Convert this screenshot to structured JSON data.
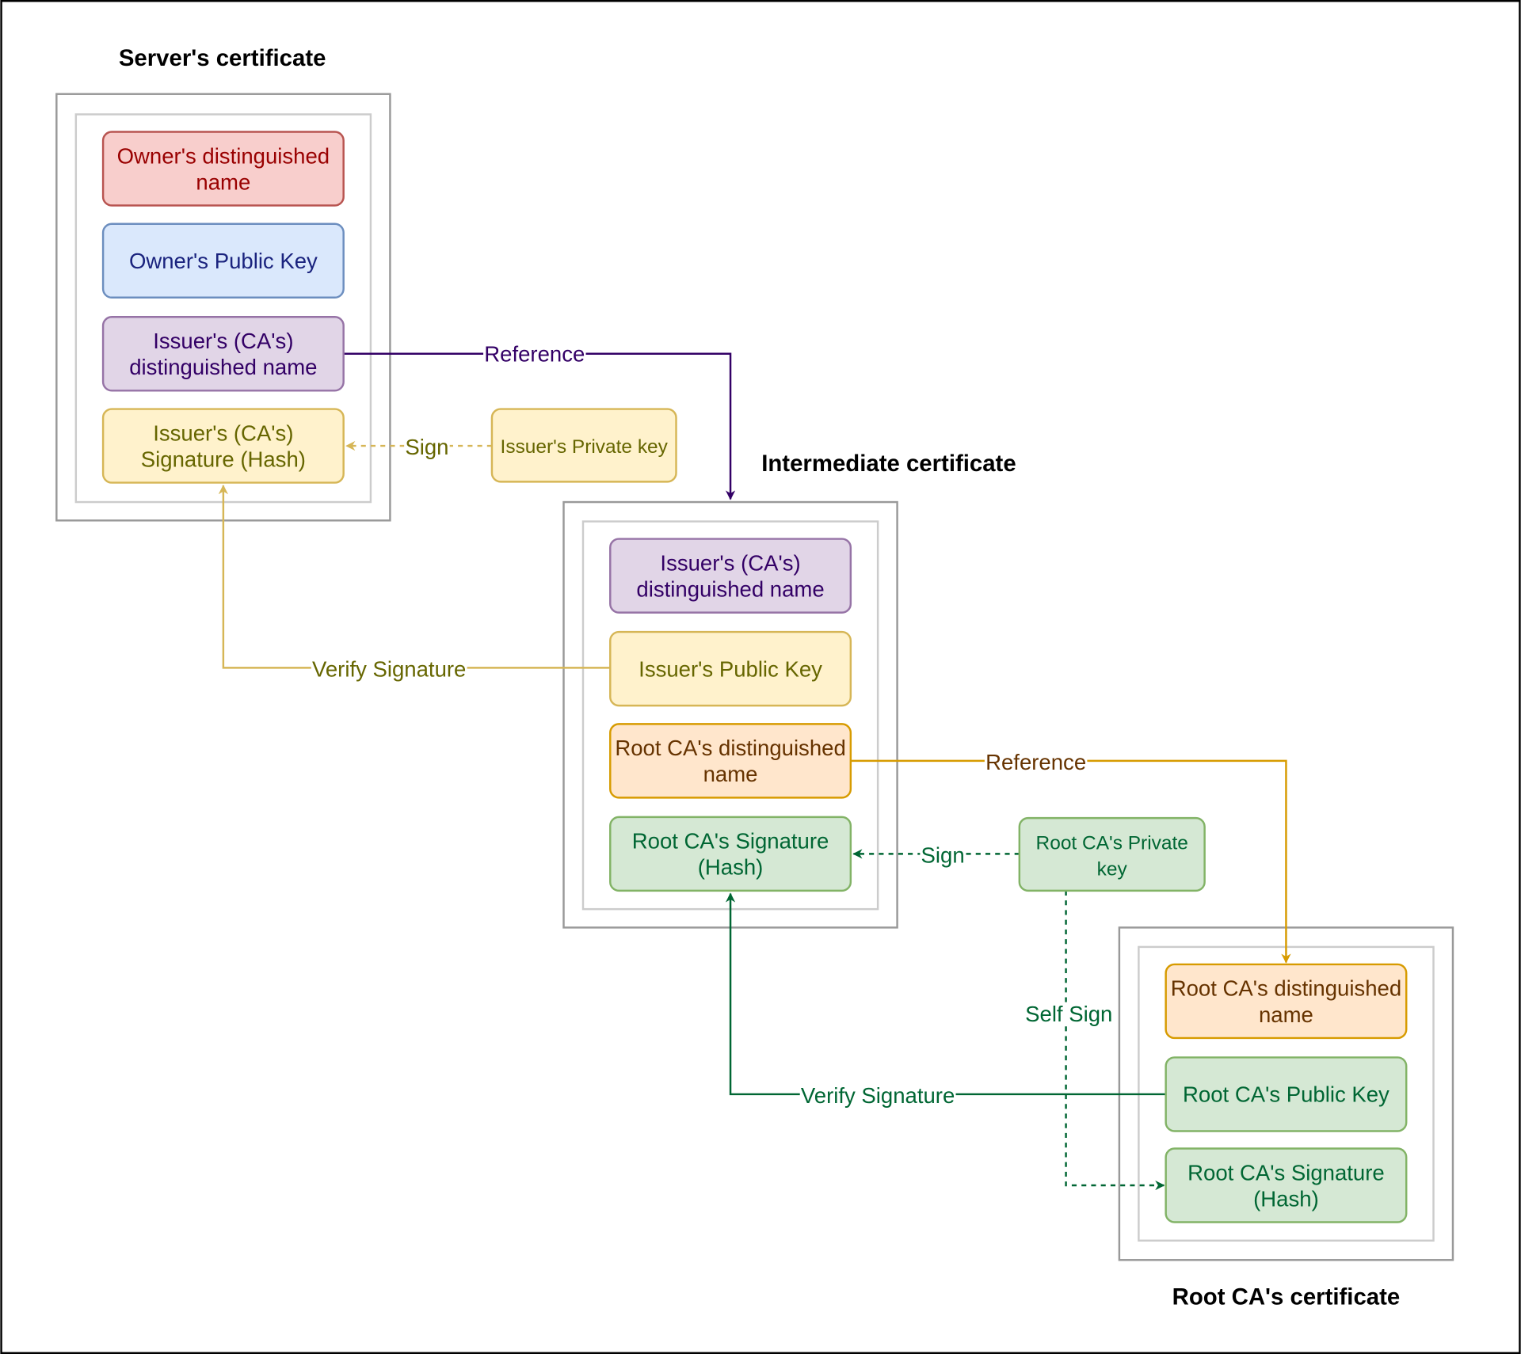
{
  "titles": {
    "server": "Server's certificate",
    "intermediate": "Intermediate certificate",
    "root": "Root CA's certificate"
  },
  "server": {
    "owner_dn": [
      "Owner's distinguished",
      "name"
    ],
    "owner_pk": [
      "Owner's Public Key"
    ],
    "issuer_dn": [
      "Issuer's (CA's)",
      "distinguished name"
    ],
    "issuer_sig": [
      "Issuer's (CA's)",
      "Signature (Hash)"
    ]
  },
  "issuer_private_key": [
    "Issuer's Private key"
  ],
  "intermediate": {
    "issuer_dn": [
      "Issuer's (CA's)",
      "distinguished name"
    ],
    "issuer_pk": [
      "Issuer's Public Key"
    ],
    "root_dn": [
      "Root CA's distinguished",
      "name"
    ],
    "root_sig": [
      "Root CA's Signature",
      "(Hash)"
    ]
  },
  "root_private_key": [
    "Root CA's Private",
    "key"
  ],
  "root": {
    "root_dn": [
      "Root CA's distinguished",
      "name"
    ],
    "root_pk": [
      "Root CA's Public Key"
    ],
    "root_sig": [
      "Root CA's Signature",
      "(Hash)"
    ]
  },
  "edges": {
    "reference_1": "Reference",
    "sign_1": "Sign",
    "verify_1": "Verify Signature",
    "reference_2": "Reference",
    "sign_2": "Sign",
    "self_sign": "Self Sign",
    "verify_2": "Verify Signature"
  },
  "colors": {
    "red": {
      "fill": "#f8cecc",
      "stroke": "#b85450",
      "text": "#990000"
    },
    "blue": {
      "fill": "#dae8fc",
      "stroke": "#6c8ebf",
      "text": "#1a237e"
    },
    "purple": {
      "fill": "#e1d5e7",
      "stroke": "#9673a6",
      "text": "#330066"
    },
    "yellow": {
      "fill": "#fff2cc",
      "stroke": "#d6b656",
      "text": "#666600"
    },
    "orange": {
      "fill": "#ffe6cc",
      "stroke": "#d79b00",
      "text": "#663300"
    },
    "green": {
      "fill": "#d5e8d4",
      "stroke": "#82b366",
      "text": "#006633"
    }
  }
}
